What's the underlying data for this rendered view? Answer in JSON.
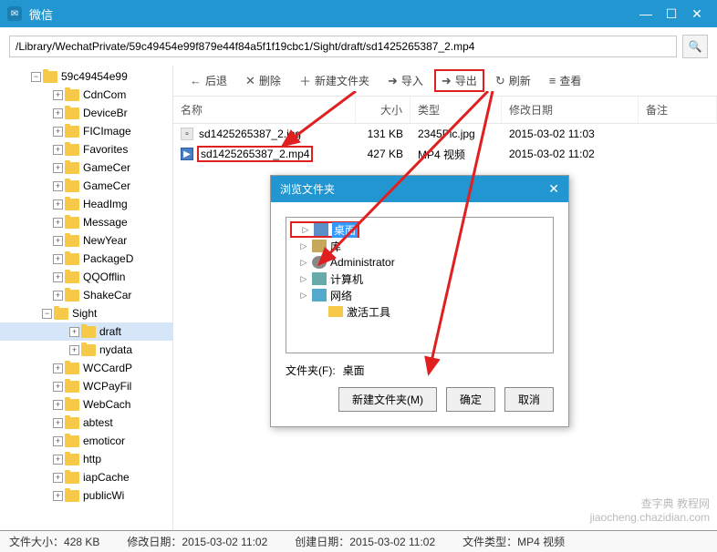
{
  "app": {
    "title": "微信"
  },
  "path": "/Library/WechatPrivate/59c49454e99f879e44f84a5f1f19cbc1/Sight/draft/sd1425265387_2.mp4",
  "toolbar": {
    "back": "后退",
    "delete": "删除",
    "newfolder": "新建文件夹",
    "import": "导入",
    "export": "导出",
    "refresh": "刷新",
    "view": "查看"
  },
  "cols": {
    "name": "名称",
    "size": "大小",
    "type": "类型",
    "date": "修改日期",
    "note": "备注"
  },
  "files": [
    {
      "name": "sd1425265387_2.jpg",
      "size": "131 KB",
      "type": "2345Pic.jpg",
      "date": "2015-03-02 11:03",
      "icon": "jpg"
    },
    {
      "name": "sd1425265387_2.mp4",
      "size": "427 KB",
      "type": "MP4 视频",
      "date": "2015-03-02 11:02",
      "icon": "mp4"
    }
  ],
  "tree": [
    "59c49454e99",
    "CdnCom",
    "DeviceBr",
    "FICImage",
    "Favorites",
    "GameCer",
    "GameCer",
    "HeadImg",
    "Message",
    "NewYear",
    "PackageD",
    "QQOfflin",
    "ShakeCar",
    "Sight",
    "draft",
    "nydata",
    "WCCardP",
    "WCPayFil",
    "WebCach",
    "abtest",
    "emoticor",
    "http",
    "iapCache",
    "publicWi"
  ],
  "dialog": {
    "title": "浏览文件夹",
    "tree": [
      {
        "label": "桌面",
        "icon": "desk",
        "sel": true
      },
      {
        "label": "库",
        "icon": "lib"
      },
      {
        "label": "Administrator",
        "icon": "user"
      },
      {
        "label": "计算机",
        "icon": "pc"
      },
      {
        "label": "网络",
        "icon": "net"
      },
      {
        "label": "激活工具",
        "icon": "fold"
      }
    ],
    "path_label": "文件夹(F):",
    "path_value": "桌面",
    "newfolder": "新建文件夹(M)",
    "ok": "确定",
    "cancel": "取消"
  },
  "status": {
    "size_label": "文件大小：",
    "size": "428 KB",
    "mdate_label": "修改日期：",
    "mdate": "2015-03-02 11:02",
    "cdate_label": "创建日期：",
    "cdate": "2015-03-02 11:02",
    "type_label": "文件类型：",
    "type": "MP4 视频"
  },
  "watermark": {
    "l1": "查字典 教程网",
    "l2": "jiaocheng.chazidian.com"
  }
}
